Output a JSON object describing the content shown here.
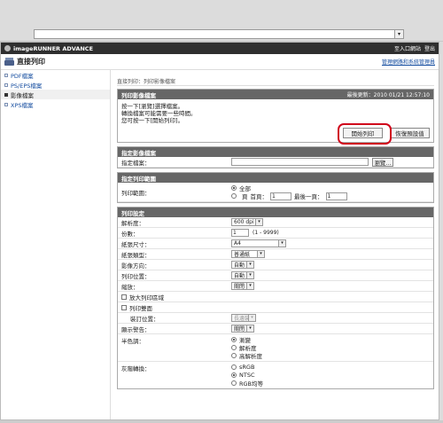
{
  "browser": {
    "address_value": "",
    "dropdown_icon": "chevron-down-icon"
  },
  "header": {
    "brand": "imageRUNNER ADVANCE",
    "links": [
      "至入口網站",
      "登出"
    ],
    "app_title": "直接列印",
    "admin_link": "管理網路和系統管理員"
  },
  "sidebar": {
    "items": [
      {
        "label": "PDF檔案",
        "active": false
      },
      {
        "label": "PS/EPS檔案",
        "active": false
      },
      {
        "label": "影像檔案",
        "active": true
      },
      {
        "label": "XPS檔案",
        "active": false
      }
    ]
  },
  "breadcrumb": "直接列印：列印影像檔案",
  "print_panel": {
    "title": "列印影像檔案",
    "updated": "最後更新：2010 01/21 12:57:10",
    "messages": [
      "按一下[瀏覽]選擇檔案。",
      "轉換檔案可能需要一些時間。",
      "您可按一下[開始列印]。"
    ],
    "start_button": "開始列印",
    "restore_button": "恢復預設值"
  },
  "file_section": {
    "title": "指定影像檔案",
    "label": "指定檔案：",
    "value": "",
    "browse_button": "瀏覽..."
  },
  "range_section": {
    "title": "指定列印範圍",
    "label": "列印範圍：",
    "option_all": "全部",
    "option_pages": "頁",
    "first_page_label": "首頁：",
    "first_page_value": "1",
    "last_page_label": "最後一頁：",
    "last_page_value": "1"
  },
  "settings": {
    "title": "列印設定",
    "resolution": {
      "label": "解析度：",
      "value": "600 dpi"
    },
    "copies": {
      "label": "份數：",
      "value": "1",
      "hint": "(1 - 9999)"
    },
    "paper_size": {
      "label": "紙張尺寸：",
      "value": "A4"
    },
    "paper_type": {
      "label": "紙張類型：",
      "value": "普通紙"
    },
    "orientation": {
      "label": "影像方向：",
      "value": "自動"
    },
    "position": {
      "label": "列印位置：",
      "value": "自動"
    },
    "zoom": {
      "label": "縮放：",
      "value": "關閉"
    },
    "enlarge_label": "放大列印區域",
    "duplex_label": "列印雙面",
    "binding": {
      "label": "裝訂位置：",
      "value": "長邊裝"
    },
    "warning": {
      "label": "顯示警告：",
      "value": "關閉"
    },
    "halftone": {
      "label": "半色調：",
      "options": [
        "漸變",
        "解析度",
        "高解析度"
      ],
      "selected": 0
    },
    "color_conversion": {
      "label": "灰階轉換：",
      "options": [
        "sRGB",
        "NTSC",
        "RGB均等"
      ],
      "selected": 1
    }
  }
}
